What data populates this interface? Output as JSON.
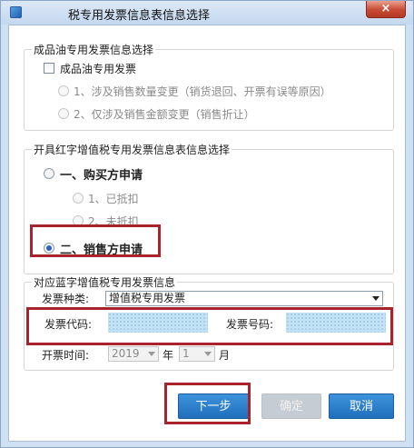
{
  "window": {
    "title": "税专用发票信息表信息选择",
    "close": "×"
  },
  "oil_group": {
    "title": "成品油专用发票信息选择",
    "checkbox_label": "成品油专用发票",
    "options": [
      "1、涉及销售数量变更（销货退回、开票有误等原因）",
      "2、仅涉及销售金额变更（销售折让）"
    ]
  },
  "red_group": {
    "title": "开具红字增值税专用发票信息表信息选择",
    "buyer_label": "一、购买方申请",
    "buyer_sub": [
      "1、已抵扣",
      "2、未抵扣"
    ],
    "seller_label": "二、销售方申请",
    "selected": "seller"
  },
  "blue_group": {
    "title": "对应蓝字增值税专用发票信息",
    "type_label": "发票种类:",
    "type_value": "增值税专用发票",
    "code_label": "发票代码:",
    "number_label": "发票号码:",
    "time_label": "开票时间:",
    "year": "2019",
    "year_unit": "年",
    "month": "1",
    "month_unit": "月"
  },
  "buttons": {
    "next": "下一步",
    "ok": "确定",
    "cancel": "取消"
  },
  "colors": {
    "highlight": "#a8232b",
    "primary": "#2a7cc9"
  }
}
